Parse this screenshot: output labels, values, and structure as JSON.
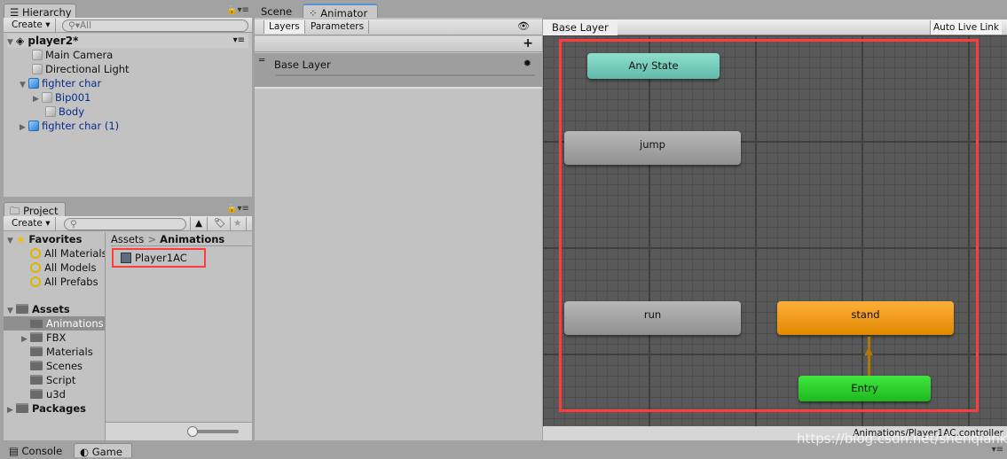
{
  "hierarchy": {
    "tab": "Hierarchy",
    "create": "Create ▾",
    "search_placeholder": "All",
    "scene": "player2*",
    "items": [
      {
        "label": "Main Camera"
      },
      {
        "label": "Directional Light"
      },
      {
        "label": "fighter char"
      },
      {
        "label": "Bip001"
      },
      {
        "label": "Body"
      },
      {
        "label": "fighter char (1)"
      }
    ]
  },
  "project": {
    "tab": "Project",
    "create": "Create ▾",
    "favorites": "Favorites",
    "favorite_items": [
      "All Materials",
      "All Models",
      "All Prefabs"
    ],
    "assets": "Assets",
    "asset_folders": [
      "Animations",
      "FBX",
      "Materials",
      "Scenes",
      "Script",
      "u3d"
    ],
    "packages": "Packages",
    "breadcrumb": [
      "Assets",
      "Animations"
    ],
    "files": [
      "Player1AC"
    ],
    "selected_folder": "Animations"
  },
  "bottom_tabs": [
    "Console",
    "Game"
  ],
  "center_tabs": [
    "Scene",
    "Animator"
  ],
  "animator": {
    "side_tabs": [
      "Layers",
      "Parameters"
    ],
    "add": "+",
    "layer": "Base Layer",
    "breadcrumb": "Base Layer",
    "auto_live_link": "Auto Live Link",
    "status_path": "Animations/Player1AC.controller",
    "states": [
      {
        "name": "Any State",
        "color": "#6cc9b8"
      },
      {
        "name": "jump",
        "color": "#a3a3a3"
      },
      {
        "name": "run",
        "color": "#a3a3a3"
      },
      {
        "name": "stand",
        "color": "#f29a1a"
      },
      {
        "name": "Entry",
        "color": "#2ecc2e"
      }
    ],
    "highlight_color": "#ff3b3b"
  },
  "watermark": "https://blog.csdn.net/shenqiankk"
}
